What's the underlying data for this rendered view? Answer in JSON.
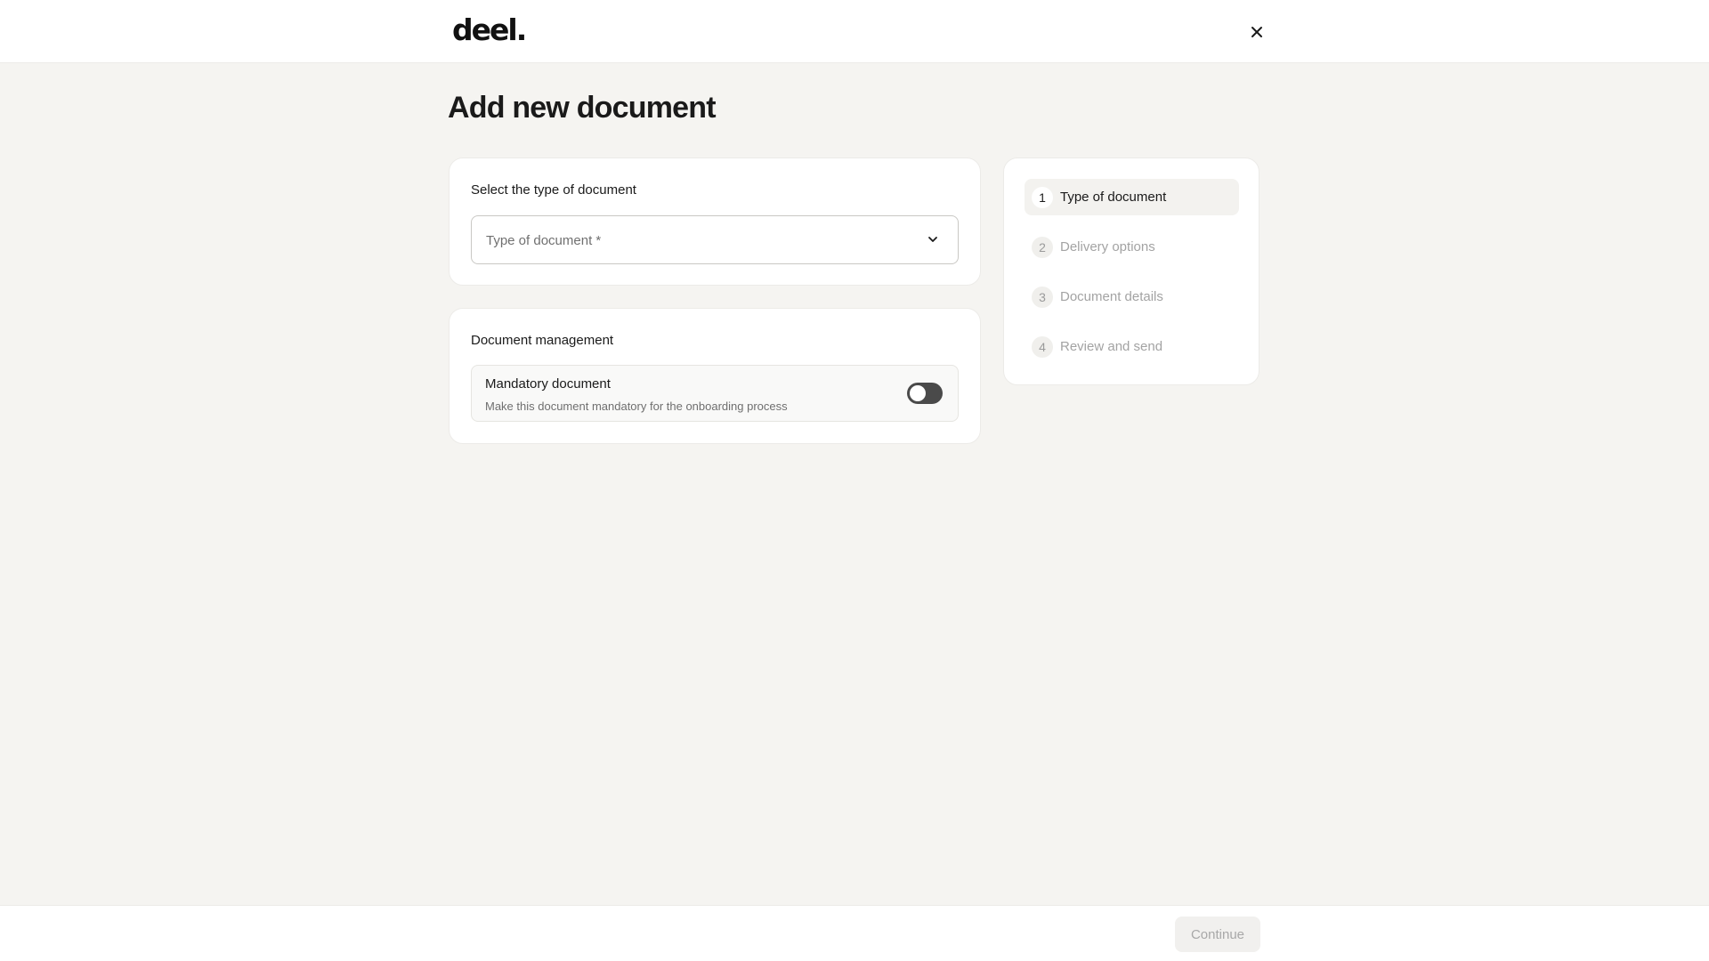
{
  "header": {
    "logo_text": "deel.",
    "close_icon": "close-icon"
  },
  "page": {
    "title": "Add new document"
  },
  "select_card": {
    "title": "Select the type of document",
    "select_placeholder": "Type of document *",
    "chevron_icon": "chevron-down-icon"
  },
  "management_card": {
    "title": "Document management",
    "toggle_title": "Mandatory document",
    "toggle_description": "Make this document mandatory for the onboarding process",
    "toggle_on": false
  },
  "steps": [
    {
      "number": "1",
      "label": "Type of document",
      "active": true
    },
    {
      "number": "2",
      "label": "Delivery options",
      "active": false
    },
    {
      "number": "3",
      "label": "Document details",
      "active": false
    },
    {
      "number": "4",
      "label": "Review and send",
      "active": false
    }
  ],
  "footer": {
    "continue_label": "Continue",
    "continue_enabled": false
  },
  "colors": {
    "background": "#f5f4f1",
    "card": "#ffffff",
    "toggle_off": "#4a4a4a",
    "disabled_text": "#a8a8a8"
  }
}
